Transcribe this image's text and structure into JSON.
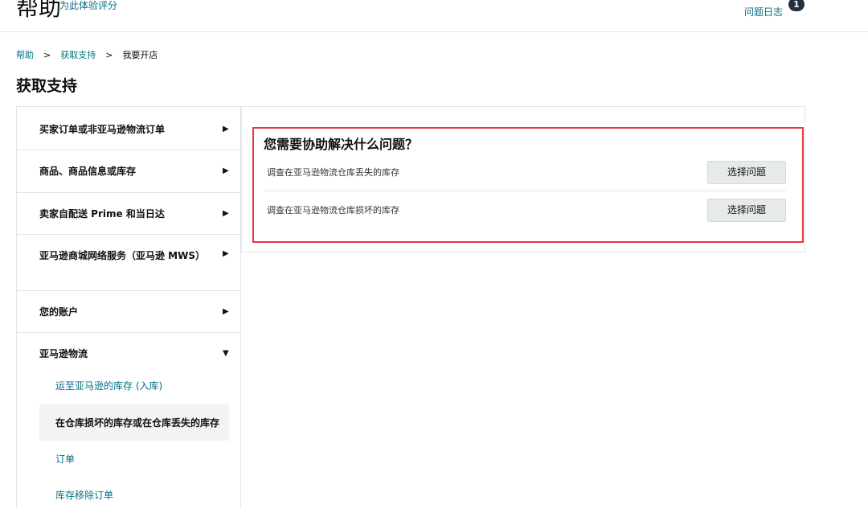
{
  "header": {
    "title": "帮助",
    "rate_link": "为此体验评分",
    "log_link": "问题日志",
    "log_badge": "1"
  },
  "breadcrumb": {
    "items": [
      "帮助",
      "获取支持",
      "我要开店"
    ],
    "separator": ">"
  },
  "page_title": "获取支持",
  "sidebar": {
    "items": [
      {
        "label": "买家订单或非亚马逊物流订单",
        "arrow": "▶"
      },
      {
        "label": "商品、商品信息或库存",
        "arrow": "▶"
      },
      {
        "label": "卖家自配送 Prime 和当日达",
        "arrow": "▶"
      },
      {
        "label": "亚马逊商城网络服务（亚马逊 MWS）",
        "arrow": "▶"
      },
      {
        "label": "您的账户",
        "arrow": "▶"
      },
      {
        "label": "亚马逊物流",
        "arrow": "▼"
      }
    ],
    "sub_items": [
      {
        "label": "运至亚马逊的库存 (入库)"
      },
      {
        "label": "在仓库损坏的库存或在仓库丢失的库存"
      },
      {
        "label": "订单"
      },
      {
        "label": "库存移除订单"
      }
    ]
  },
  "main": {
    "question": "您需要协助解决什么问题？",
    "issues": [
      {
        "text": "调查在亚马逊物流仓库丢失的库存",
        "button": "选择问题"
      },
      {
        "text": "调查在亚马逊物流仓库损坏的库存",
        "button": "选择问题"
      }
    ]
  },
  "colors": {
    "link": "#007185",
    "highlight_border": "#e03a3e",
    "button_bg": "#e7eaea",
    "badge_bg": "#232f3e"
  }
}
